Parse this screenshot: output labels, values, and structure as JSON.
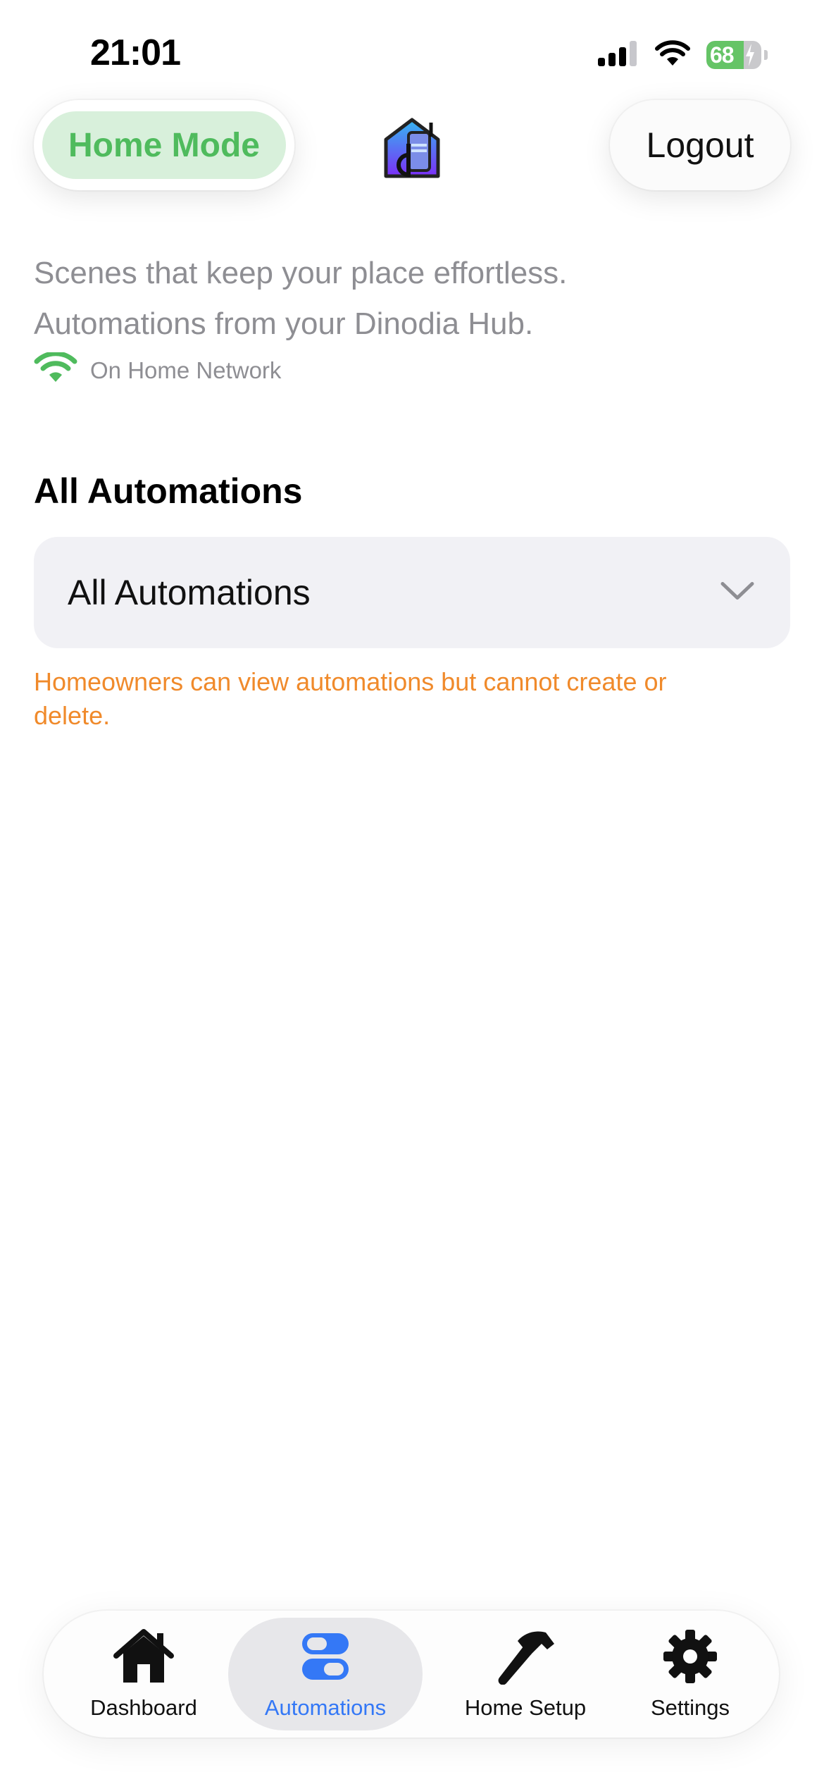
{
  "status_bar": {
    "time": "21:01",
    "battery_percent": "68",
    "battery_level": 0.68,
    "icons": [
      "cellular-signal-icon",
      "wifi-icon",
      "battery-charging-icon"
    ]
  },
  "header": {
    "mode_label": "Home Mode",
    "logout_label": "Logout",
    "logo_icon": "dinodia-logo-icon"
  },
  "intro": {
    "line1": "Scenes that keep your place effortless.",
    "line2": "Automations from your Dinodia Hub.",
    "network_status": "On Home Network"
  },
  "automations": {
    "section_title": "All Automations",
    "filter_selected": "All Automations",
    "notice": "Homeowners can view automations but cannot create or delete."
  },
  "tabbar": {
    "tabs": [
      {
        "label": "Dashboard",
        "icon": "house-icon",
        "active": false
      },
      {
        "label": "Automations",
        "icon": "toggles-icon",
        "active": true
      },
      {
        "label": "Home Setup",
        "icon": "hammer-icon",
        "active": false
      },
      {
        "label": "Settings",
        "icon": "gear-icon",
        "active": false
      }
    ]
  },
  "colors": {
    "mode_green": "#4fbb5d",
    "mode_green_bg": "#d8f0db",
    "notice_orange": "#f08a2b",
    "active_blue": "#3478f6",
    "muted_gray": "#8e8e93"
  }
}
